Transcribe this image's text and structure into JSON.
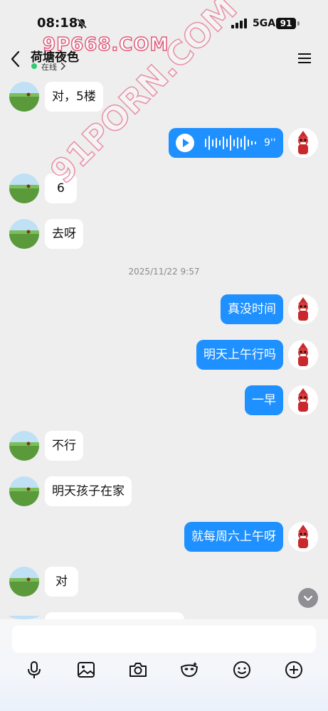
{
  "status_bar": {
    "time": "08:18",
    "network": "5GA",
    "battery": "91"
  },
  "watermarks": {
    "top": "9P668.COM",
    "diagonal": "91PORN.COM"
  },
  "header": {
    "title": "荷塘夜色",
    "status": "在线"
  },
  "messages": [
    {
      "side": "left",
      "text": "对，5楼"
    },
    {
      "side": "right",
      "type": "voice",
      "duration": "9''"
    },
    {
      "side": "left",
      "text": "6"
    },
    {
      "side": "left",
      "text": "去呀"
    },
    {
      "side": "timestamp",
      "text": "2025/11/22 9:57"
    },
    {
      "side": "right",
      "text": "真没时间"
    },
    {
      "side": "right",
      "text": "明天上午行吗"
    },
    {
      "side": "right",
      "text": "一早"
    },
    {
      "side": "left",
      "text": "不行"
    },
    {
      "side": "left",
      "text": "明天孩子在家"
    },
    {
      "side": "right",
      "text": "就每周六上午呀"
    },
    {
      "side": "left",
      "text": "对"
    }
  ],
  "colors": {
    "accent": "#1e90ff",
    "online": "#2ecc71",
    "background": "#eeeeef"
  },
  "toolbar": [
    "microphone-icon",
    "image-icon",
    "camera-icon",
    "mask-icon",
    "emoji-icon",
    "plus-icon"
  ]
}
